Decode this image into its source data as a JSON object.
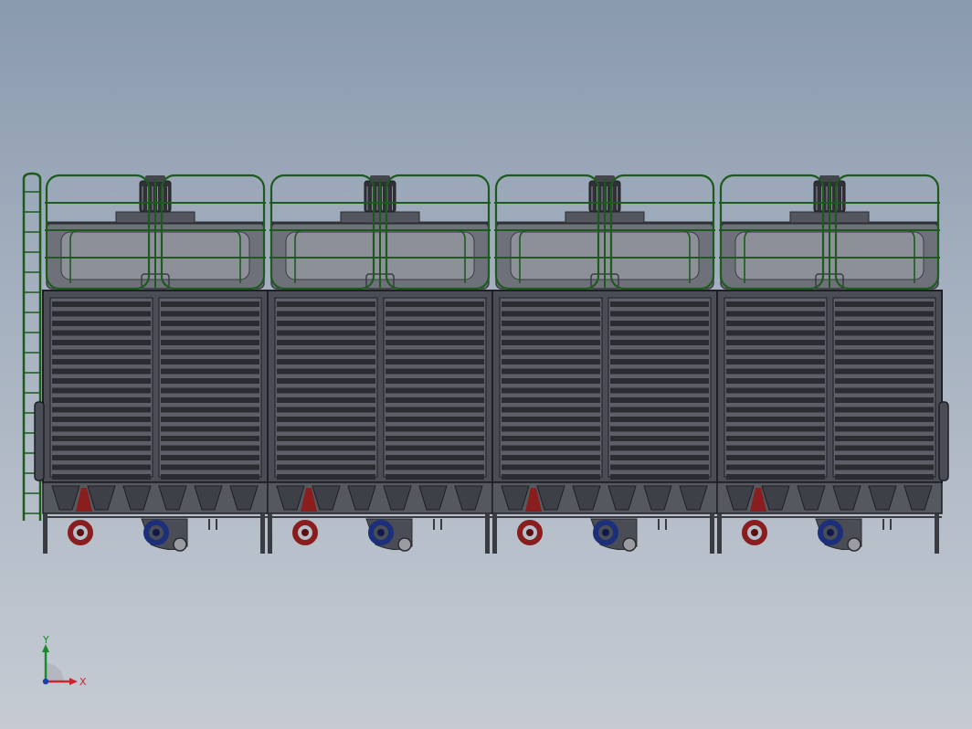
{
  "scene": {
    "model": "cooling-tower-assembly",
    "modules": 4,
    "background_top": "#8a9aae",
    "background_bottom": "#c6cbd3"
  },
  "colors": {
    "railing": "#1d5a1d",
    "casing": "#4a4d55",
    "louver_dark": "#2a2c32",
    "louver_light": "#5c5f68",
    "fan_deck": "#6e7179",
    "basin": "#55585f",
    "hot_water_pipe": "#8a1e1e",
    "cold_water_pipe": "#1c2f7a",
    "motor": "#2f3137"
  },
  "triad": {
    "x_label": "X",
    "y_label": "Y",
    "x_color": "#c8282d",
    "y_color": "#1a8a2e",
    "z_color": "#1f3ea8"
  }
}
